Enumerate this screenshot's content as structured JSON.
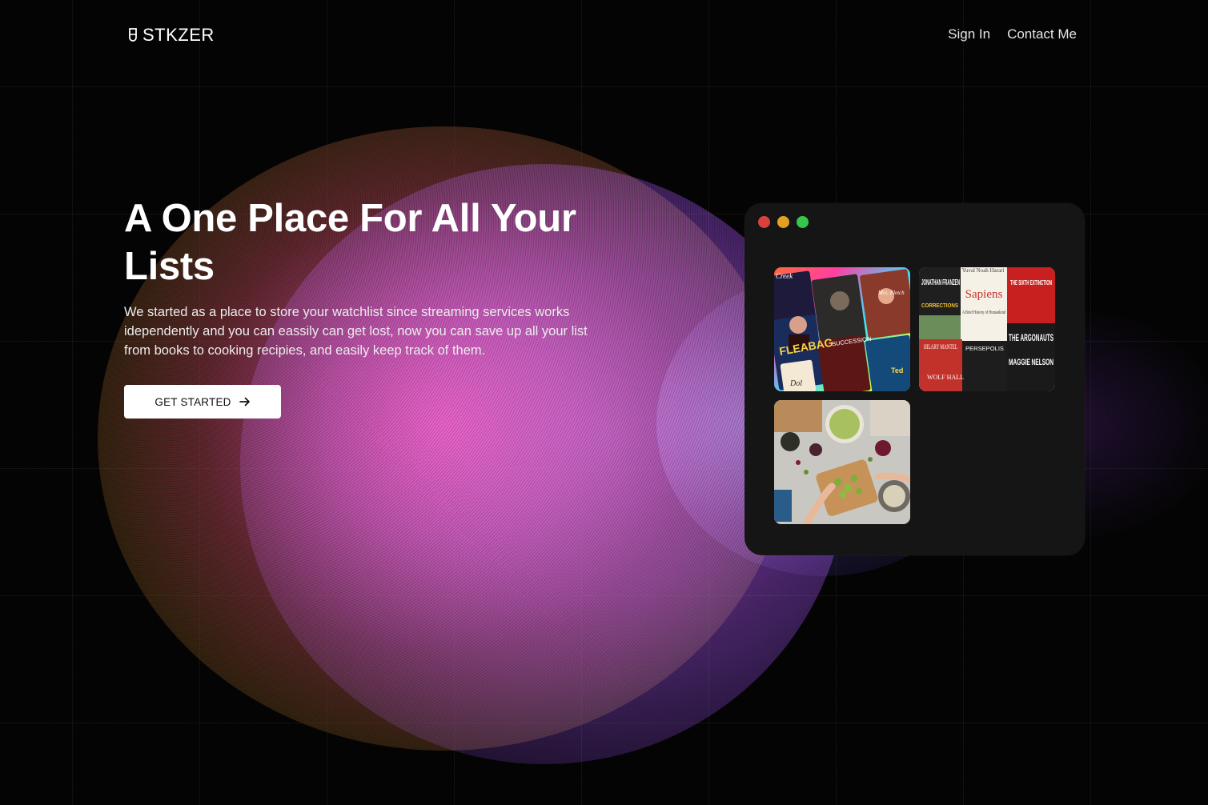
{
  "brand": {
    "name": "STKZER",
    "icon": "shield-outline-icon"
  },
  "nav": {
    "sign_in": "Sign In",
    "contact": "Contact Me"
  },
  "hero": {
    "title": "A One Place For All Your Lists",
    "description": "We started as a place to store your watchlist since streaming services works idependently and you can eassily can get lost, now you can save up all your list from books to cooking recipies, and easily keep track of them.",
    "cta_label": "GET STARTED",
    "cta_icon": "arrow-right-icon"
  },
  "window": {
    "dots": [
      "#d94040",
      "#e2a21f",
      "#34c749"
    ],
    "tiles": [
      {
        "id": "shows",
        "lines": [
          "Creek",
          "Mrs. Fletch",
          "FLEABAG",
          "SUCCESSION",
          "Dol",
          "Ted"
        ]
      },
      {
        "id": "books",
        "lines": [
          "Yuval Noah Harari",
          "JONATHAN FRANZEN",
          "CORRECTIONS",
          "Sapiens",
          "A Brief History of Humankind",
          "THE SIXTH EXTINCTION",
          "HILARY MANTEL",
          "WOLF HALL",
          "PERSEPOLIS",
          "THE ARGONAUTS",
          "MAGGIE NELSON"
        ]
      },
      {
        "id": "food"
      }
    ]
  }
}
